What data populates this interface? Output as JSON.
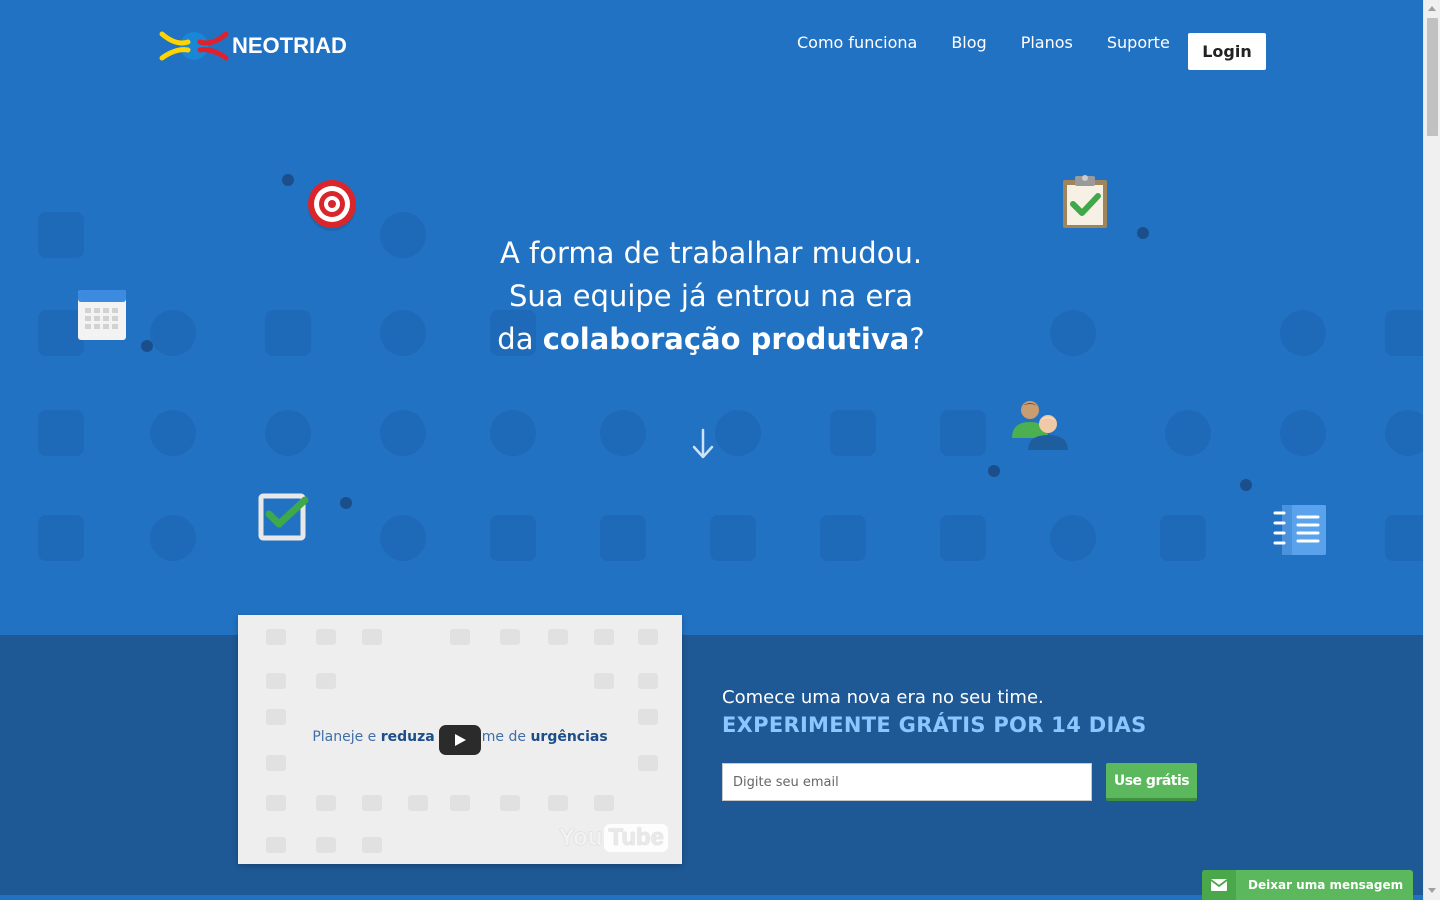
{
  "header": {
    "logo_text": "NEOTRIAD",
    "nav": [
      {
        "label": "Como funciona"
      },
      {
        "label": "Blog"
      },
      {
        "label": "Planos"
      },
      {
        "label": "Suporte"
      }
    ],
    "login_label": "Login"
  },
  "hero": {
    "line1": "A forma de trabalhar mudou.",
    "line2": "Sua equipe já entrou na era",
    "line3_prefix": "da ",
    "line3_bold": "colaboração produtiva",
    "line3_suffix": "?"
  },
  "video": {
    "caption_part1": "Planeje e ",
    "caption_bold1": "reduza",
    "caption_part2": " o volume de ",
    "caption_bold2": "urgências",
    "watermark_you": "You",
    "watermark_tube": "Tube"
  },
  "signup": {
    "line1": "Comece uma nova era no seu time.",
    "line2": "EXPERIMENTE GRÁTIS POR 14 DIAS",
    "email_placeholder": "Digite seu email",
    "button_label": "Use grátis"
  },
  "chat_widget": {
    "label": "Deixar uma mensagem"
  },
  "colors": {
    "hero_bg": "#2272c3",
    "band_bg": "#1e5996",
    "accent_green": "#5cb85c",
    "cta_highlight": "#8dc5ff"
  },
  "icons": [
    "target-icon",
    "clipboard-check-icon",
    "calendar-icon",
    "users-icon",
    "checkbox-icon",
    "notebook-icon",
    "down-arrow-icon",
    "play-icon",
    "envelope-icon"
  ]
}
